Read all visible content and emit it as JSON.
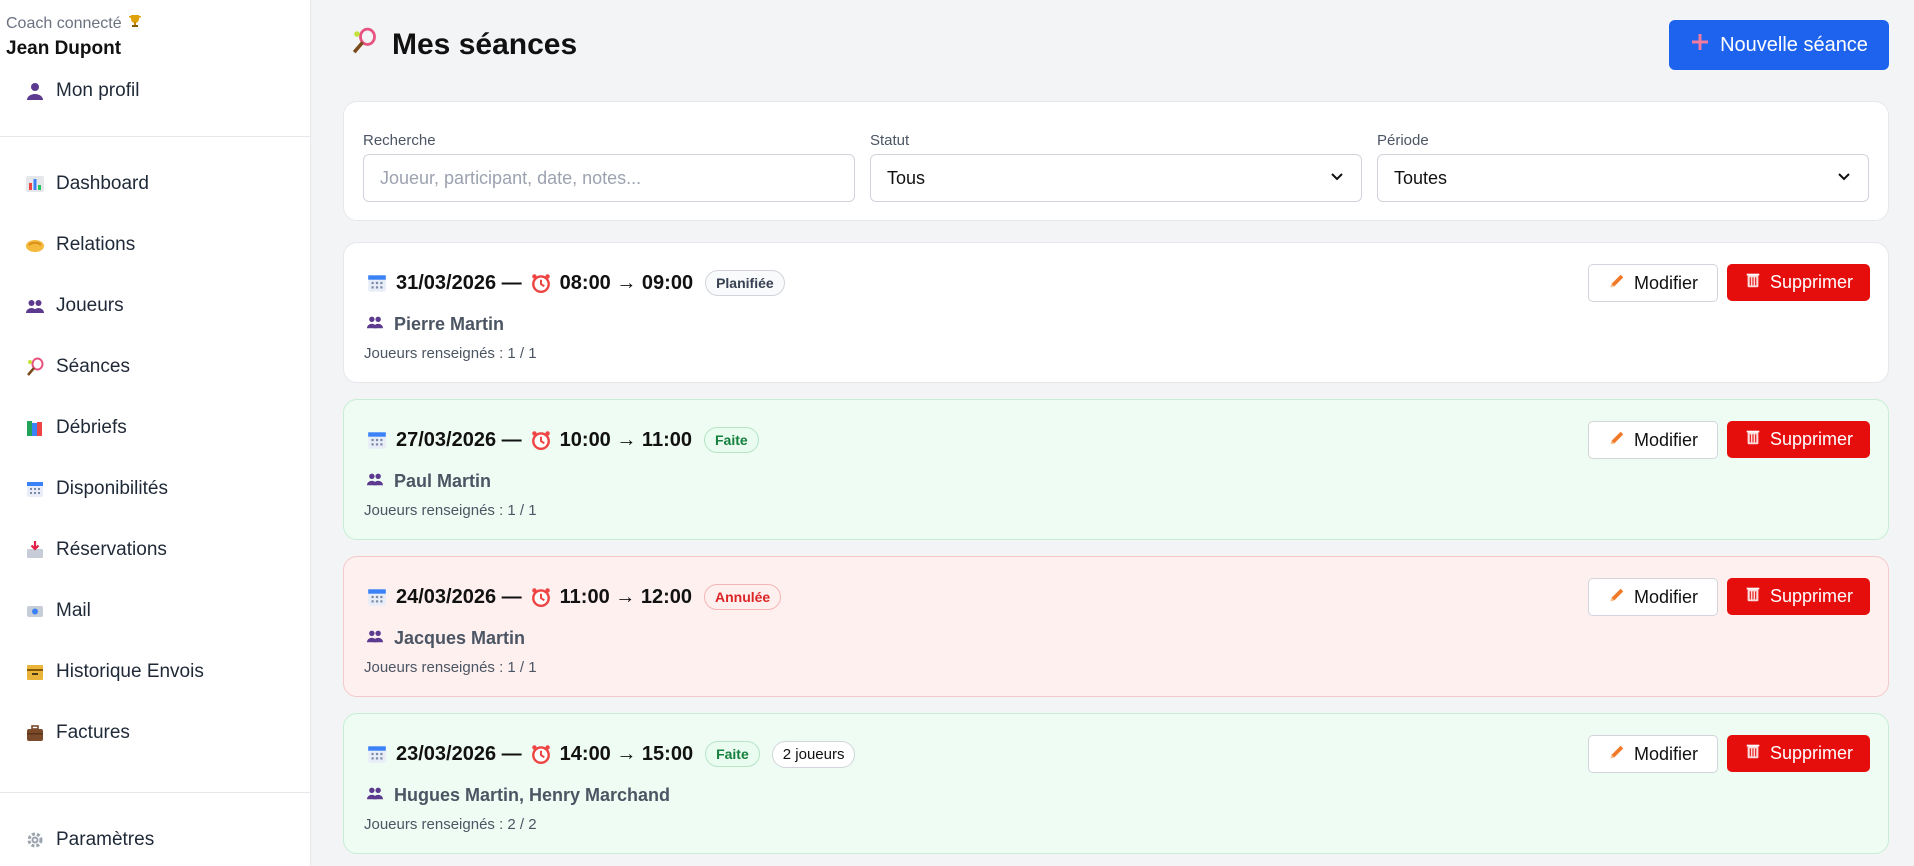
{
  "sidebar": {
    "coach_label": "Coach connecté",
    "coach_name": "Jean Dupont",
    "profile_label": "Mon profil",
    "items": [
      {
        "label": "Dashboard",
        "icon": "bar-chart-icon"
      },
      {
        "label": "Relations",
        "icon": "handshake-icon"
      },
      {
        "label": "Joueurs",
        "icon": "users-icon"
      },
      {
        "label": "Séances",
        "icon": "racket-icon"
      },
      {
        "label": "Débriefs",
        "icon": "books-icon"
      },
      {
        "label": "Disponibilités",
        "icon": "calendar-icon"
      },
      {
        "label": "Réservations",
        "icon": "inbox-icon"
      },
      {
        "label": "Mail",
        "icon": "mail-icon"
      },
      {
        "label": "Historique Envois",
        "icon": "archive-icon"
      },
      {
        "label": "Factures",
        "icon": "briefcase-icon"
      }
    ],
    "settings_label": "Paramètres"
  },
  "header": {
    "title": "Mes séances",
    "new_button": "Nouvelle séance"
  },
  "filters": {
    "search_label": "Recherche",
    "search_placeholder": "Joueur, participant, date, notes...",
    "status_label": "Statut",
    "status_value": "Tous",
    "period_label": "Période",
    "period_value": "Toutes"
  },
  "actions": {
    "edit": "Modifier",
    "delete": "Supprimer"
  },
  "sessions": [
    {
      "date": "31/03/2026 —",
      "time": "08:00 → 09:00",
      "status": "Planifiée",
      "count": "",
      "players": "Pierre Martin",
      "meta": "Joueurs renseignés : 1 / 1"
    },
    {
      "date": "27/03/2026 —",
      "time": "10:00 → 11:00",
      "status": "Faite",
      "count": "",
      "players": "Paul Martin",
      "meta": "Joueurs renseignés : 1 / 1"
    },
    {
      "date": "24/03/2026 —",
      "time": "11:00 → 12:00",
      "status": "Annulée",
      "count": "",
      "players": "Jacques Martin",
      "meta": "Joueurs renseignés : 1 / 1"
    },
    {
      "date": "23/03/2026 —",
      "time": "14:00 → 15:00",
      "status": "Faite",
      "count": "2 joueurs",
      "players": "Hugues Martin, Henry Marchand",
      "meta": "Joueurs renseignés : 2 / 2"
    }
  ],
  "colors": {
    "primary": "#1d63ed",
    "danger": "#e60d0d",
    "done_bg": "#effcf3",
    "cancel_bg": "#fff0f0"
  }
}
